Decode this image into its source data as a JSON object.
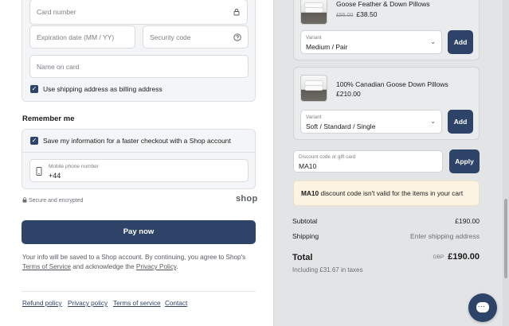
{
  "payment": {
    "card_number_placeholder": "Card number",
    "expiration_placeholder": "Expiration date (MM / YY)",
    "security_placeholder": "Security code",
    "name_placeholder": "Name on card",
    "billing_checkbox_label": "Use shipping address as billing address",
    "billing_checked": true
  },
  "remember": {
    "heading": "Remember me",
    "save_label": "Save my information for a faster checkout with a Shop account",
    "save_checked": true,
    "phone_label": "Mobile phone number",
    "phone_value": "+44"
  },
  "secure_text": "Secure and encrypted",
  "shop_logo": "shop",
  "pay_button": "Pay now",
  "info": {
    "text_1": "Your info will be saved to a Shop account. By continuing, you agree to Shop's",
    "terms_link": "Terms of Service",
    "text_2": "and acknowledge the",
    "privacy_link": "Privacy Policy",
    "text_3": "."
  },
  "footer_links": [
    "Refund policy",
    "Privacy policy",
    "Terms of service",
    "Contact"
  ],
  "products": [
    {
      "name": "Goose Feather & Down Pillows",
      "old_price": "£55.00",
      "price": "£38.50",
      "variant_label": "Variant",
      "variant_value": "Medium / Pair",
      "add_label": "Add"
    },
    {
      "name": "100% Canadian Goose Down Pillows",
      "price": "£210.00",
      "variant_label": "Variant",
      "variant_value": "Soft / Standard / Single",
      "add_label": "Add"
    }
  ],
  "discount": {
    "label": "Discount code or gift card",
    "value": "MA10",
    "apply_label": "Apply",
    "alert_code": "MA10",
    "alert_text": "discount code isn't valid for the items in your cart"
  },
  "summary": {
    "subtotal_label": "Subtotal",
    "subtotal_value": "£190.00",
    "shipping_label": "Shipping",
    "shipping_value": "Enter shipping address",
    "total_label": "Total",
    "currency": "GBP",
    "total_value": "£190.00",
    "taxes_text": "Including £31.67 in taxes"
  },
  "colors": {
    "primary": "#2d4468",
    "summary_bg": "#e2e4e6",
    "alert_bg": "#fdf3e2"
  }
}
